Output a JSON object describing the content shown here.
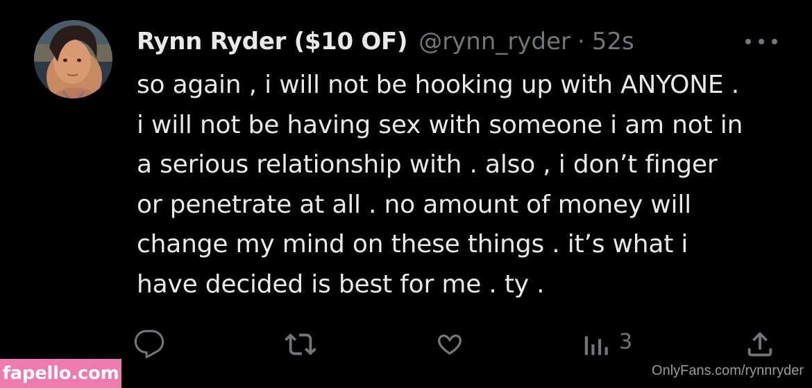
{
  "tweet": {
    "display_name": "Rynn Ryder ($10 OF)",
    "handle": "@rynn_ryder",
    "separator": "·",
    "timestamp": "52s",
    "text": "so again , i will not be hooking up with ANYONE .\ni will not be having sex with someone i am not in\na serious relationship with . also , i don’t finger\nor penetrate at all . no amount of money will\nchange my mind on these things . it’s what i\nhave decided is best for me . ty ."
  },
  "actions": {
    "reply_icon": "reply-bubble-icon",
    "retweet_icon": "retweet-icon",
    "like_icon": "heart-icon",
    "views_icon": "views-chart-icon",
    "views_count": "3",
    "share_icon": "share-icon"
  },
  "watermarks": {
    "left": "fapello.com",
    "right": "OnlyFans.com/rynnryder"
  },
  "colors": {
    "background": "#000000",
    "text_primary": "#e7e9ea",
    "text_secondary": "#71767b",
    "watermark_pink": "#ef7ab0"
  }
}
